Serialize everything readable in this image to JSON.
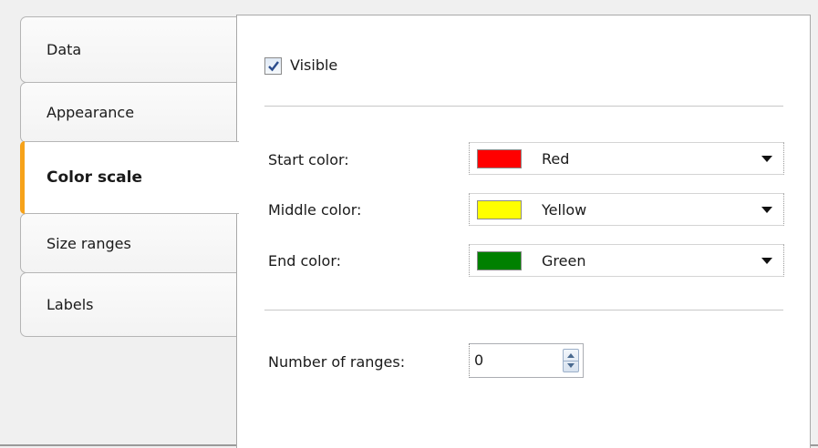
{
  "tabs": [
    {
      "label": "Data"
    },
    {
      "label": "Appearance"
    },
    {
      "label": "Color scale",
      "active": true
    },
    {
      "label": "Size ranges"
    },
    {
      "label": "Labels"
    }
  ],
  "visible": {
    "label": "Visible",
    "checked": true
  },
  "colors": {
    "start": {
      "label": "Start color:",
      "value": "Red",
      "hex": "#ff0000"
    },
    "middle": {
      "label": "Middle color:",
      "value": "Yellow",
      "hex": "#ffff00"
    },
    "end": {
      "label": "End color:",
      "value": "Green",
      "hex": "#008000"
    }
  },
  "ranges": {
    "label": "Number of ranges:",
    "value": "0"
  },
  "theme": {
    "active_tab_accent": "#f6a21a"
  }
}
